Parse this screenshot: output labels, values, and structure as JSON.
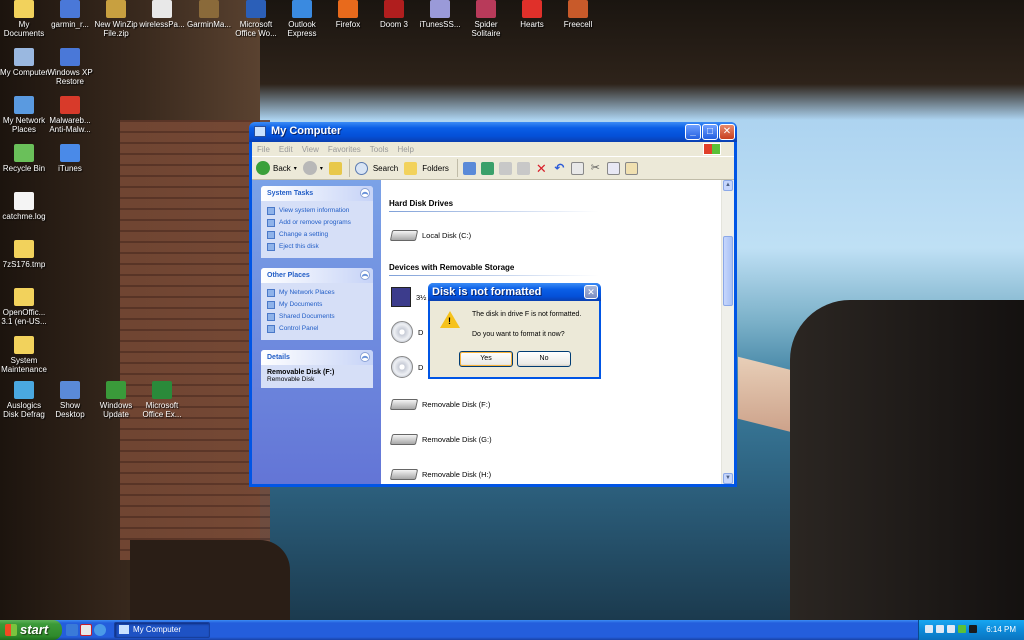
{
  "desktop": {
    "icons": [
      {
        "label": "My Documents",
        "icon": "my-documents-icon",
        "color": "#f2d25c"
      },
      {
        "label": "garmin_r...",
        "icon": "window-icon",
        "color": "#4a78d8"
      },
      {
        "label": "New WinZip File.zip",
        "icon": "winzip-icon",
        "color": "#c8a040"
      },
      {
        "label": "wirelessPa...",
        "icon": "document-icon",
        "color": "#e8e8e8"
      },
      {
        "label": "GarminMa...",
        "icon": "box-icon",
        "color": "#8a6a3a"
      },
      {
        "label": "Microsoft Office Wo...",
        "icon": "word-icon",
        "color": "#2b5fb8"
      },
      {
        "label": "Outlook Express",
        "icon": "outlook-icon",
        "color": "#3a8ae0"
      },
      {
        "label": "Firefox",
        "icon": "firefox-icon",
        "color": "#e86a1c"
      },
      {
        "label": "Doom 3",
        "icon": "doom-icon",
        "color": "#b01e1e"
      },
      {
        "label": "iTunesSS...",
        "icon": "itunes-setup-icon",
        "color": "#9a9ad8"
      },
      {
        "label": "Spider Solitaire",
        "icon": "spider-icon",
        "color": "#b83a5a"
      },
      {
        "label": "Hearts",
        "icon": "heart-icon",
        "color": "#e0302a"
      },
      {
        "label": "Freecell",
        "icon": "cards-icon",
        "color": "#c85a2a"
      },
      {
        "label": "My Computer",
        "icon": "computer-icon",
        "color": "#9ab8e0"
      },
      {
        "label": "Windows XP Restore",
        "icon": "window-icon",
        "color": "#4a78d8"
      },
      {
        "label": "My Network Places",
        "icon": "network-icon",
        "color": "#5a9ae0"
      },
      {
        "label": "Malwareb... Anti-Malw...",
        "icon": "malwarebytes-icon",
        "color": "#d83a2a"
      },
      {
        "label": "Recycle Bin",
        "icon": "recycle-bin-icon",
        "color": "#6ac05a"
      },
      {
        "label": "iTunes",
        "icon": "itunes-icon",
        "color": "#4a8ae8"
      },
      {
        "label": "catchme.log",
        "icon": "text-file-icon",
        "color": "#f4f4f4"
      },
      {
        "label": "7zS176.tmp",
        "icon": "folder-icon",
        "color": "#f2d25c"
      },
      {
        "label": "OpenOffic... 3.1 (en-US...",
        "icon": "folder-icon",
        "color": "#f2d25c"
      },
      {
        "label": "System Maintenance",
        "icon": "folder-icon",
        "color": "#f2d25c"
      },
      {
        "label": "Auslogics Disk Defrag",
        "icon": "defrag-icon",
        "color": "#4aa8e0"
      },
      {
        "label": "Show Desktop",
        "icon": "show-desktop-icon",
        "color": "#5a8ad8"
      },
      {
        "label": "Windows Update",
        "icon": "windows-update-icon",
        "color": "#3a9a3a"
      },
      {
        "label": "Microsoft Office Ex...",
        "icon": "excel-icon",
        "color": "#2a8a3a"
      }
    ]
  },
  "window": {
    "title": "My Computer",
    "menu": [
      "File",
      "Edit",
      "View",
      "Favorites",
      "Tools",
      "Help"
    ],
    "toolbar": {
      "back": "Back",
      "search": "Search",
      "folders": "Folders"
    },
    "system_tasks": {
      "title": "System Tasks",
      "links": [
        "View system information",
        "Add or remove programs",
        "Change a setting",
        "Eject this disk"
      ]
    },
    "other_places": {
      "title": "Other Places",
      "links": [
        "My Network Places",
        "My Documents",
        "Shared Documents",
        "Control Panel"
      ]
    },
    "details": {
      "title": "Details",
      "name": "Removable Disk (F:)",
      "type": "Removable Disk"
    },
    "groups": {
      "hdd": "Hard Disk Drives",
      "removable": "Devices with Removable Storage"
    },
    "drives": {
      "c": "Local Disk (C:)",
      "floppy": "3½",
      "d1": "D",
      "d2": "D",
      "f": "Removable Disk (F:)",
      "g": "Removable Disk (G:)",
      "h": "Removable Disk (H:)"
    }
  },
  "dialog": {
    "title": "Disk is not formatted",
    "message": "The disk in drive F is not formatted.",
    "question": "Do you want to format it now?",
    "yes": "Yes",
    "no": "No"
  },
  "taskbar": {
    "start": "start",
    "task": "My Computer",
    "clock": "6:14 PM"
  }
}
